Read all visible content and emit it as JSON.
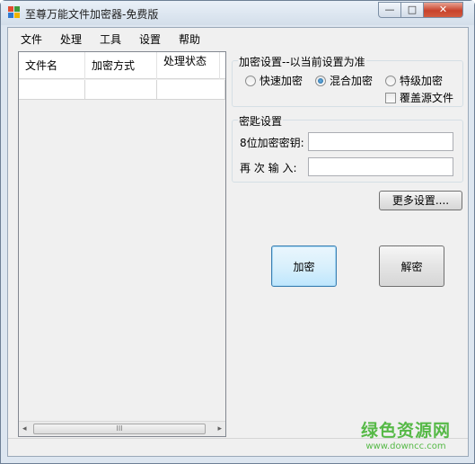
{
  "window": {
    "title": "至尊万能文件加密器-免费版",
    "controls": {
      "minimize": "—",
      "maximize": "□",
      "close": "✕"
    }
  },
  "menu": [
    "文件",
    "处理",
    "工具",
    "设置",
    "帮助"
  ],
  "file_list": {
    "columns": [
      "文件名",
      "加密方式",
      "处理状态"
    ],
    "scroll_thumb": "III"
  },
  "encryption_settings": {
    "title": "加密设置--以当前设置为准",
    "options": [
      "快速加密",
      "混合加密",
      "特级加密"
    ],
    "selected": "混合加密",
    "overwrite_label": "覆盖源文件",
    "overwrite_checked": false
  },
  "key_settings": {
    "title": "密匙设置",
    "key_label": "8位加密密钥:",
    "key_value": "",
    "confirm_label": "再 次 输 入:",
    "confirm_value": ""
  },
  "buttons": {
    "more": "更多设置....",
    "encrypt": "加密",
    "decrypt": "解密"
  },
  "watermark": {
    "brand": "绿色资源网",
    "url": "www.downcc.com"
  },
  "colors": {
    "title_bar": "#dde6f0",
    "close_button": "#c8432c",
    "watermark": "#56b947",
    "focus_border": "#3c7fb1"
  }
}
